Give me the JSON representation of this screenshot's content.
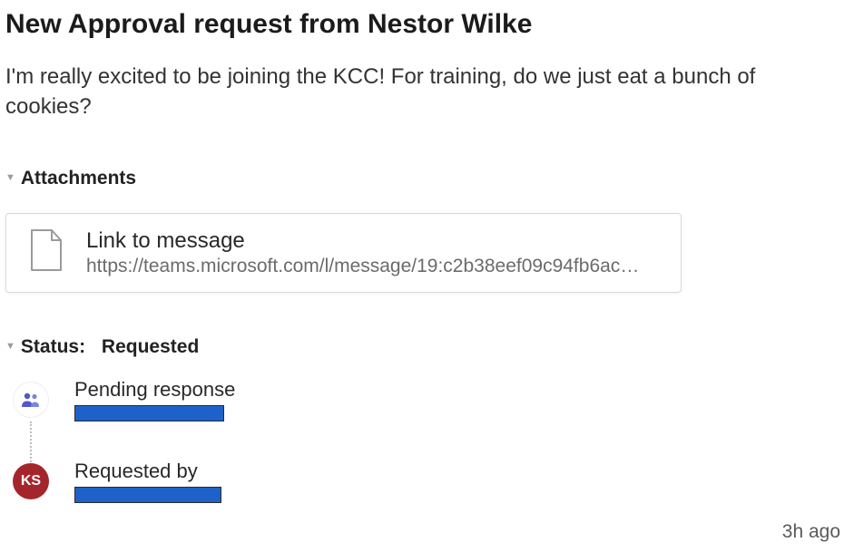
{
  "title": "New Approval request from Nestor Wilke",
  "body": "I'm really excited to be joining the KCC! For training, do we just eat a bunch of cookies?",
  "attachments": {
    "header": "Attachments",
    "card": {
      "title": "Link to message",
      "url": "https://teams.microsoft.com/l/message/19:c2b38eef09c94fb6ac6e..."
    }
  },
  "status": {
    "header_prefix": "Status:",
    "value": "Requested",
    "timeline": {
      "pending": {
        "label": "Pending response"
      },
      "requested_by": {
        "label": "Requested by",
        "avatar_initials": "KS"
      }
    }
  },
  "timestamp": "3h ago",
  "icons": {
    "caret": "caret-down-icon",
    "file": "file-icon",
    "people": "people-icon"
  },
  "colors": {
    "accent_avatar": "#a4262c",
    "redaction": "#1e62c9",
    "body_text": "#333333",
    "muted_text": "#6b6b6b"
  }
}
